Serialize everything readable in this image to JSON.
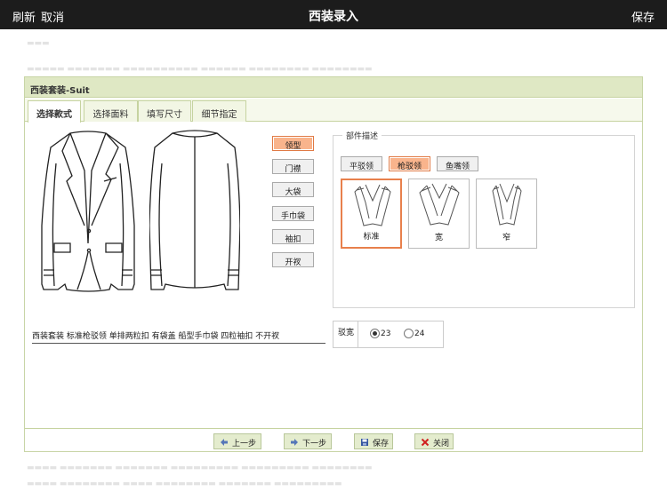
{
  "topbar": {
    "refresh": "刷新",
    "cancel": "取消",
    "title": "西装录入",
    "save": "保存"
  },
  "dialog": {
    "title": "西装套装-Suit",
    "tabs": [
      {
        "label": "选择款式",
        "active": true
      },
      {
        "label": "选择面料",
        "active": false
      },
      {
        "label": "填写尺寸",
        "active": false
      },
      {
        "label": "细节指定",
        "active": false
      }
    ],
    "parts": [
      {
        "label": "领型",
        "selected": true
      },
      {
        "label": "门襟",
        "selected": false
      },
      {
        "label": "大袋",
        "selected": false
      },
      {
        "label": "手巾袋",
        "selected": false
      },
      {
        "label": "袖扣",
        "selected": false
      },
      {
        "label": "开衩",
        "selected": false
      }
    ],
    "fieldset_legend": "部件描述",
    "lapel_types": [
      {
        "label": "平驳领",
        "selected": false
      },
      {
        "label": "枪驳领",
        "selected": true
      },
      {
        "label": "鱼嘴领",
        "selected": false
      }
    ],
    "widths": [
      {
        "label": "标准",
        "selected": true
      },
      {
        "label": "宽",
        "selected": false
      },
      {
        "label": "窄",
        "selected": false
      }
    ],
    "description": "西装套装 标准枪驳领 单排两粒扣 有袋盖 船型手巾袋 四粒袖扣 不开衩",
    "lapel_width": {
      "label": "驳宽",
      "options": [
        {
          "label": "23",
          "selected": true
        },
        {
          "label": "24",
          "selected": false
        }
      ]
    },
    "footer": {
      "prev": "上一步",
      "next": "下一步",
      "save": "保存",
      "close": "关闭"
    }
  },
  "colors": {
    "topbar_bg": "#1c1c1c",
    "header_bg": "#dfe8c4",
    "selected_fill": "#f9b48c",
    "selected_border": "#e07a45",
    "footer_btn_bg": "#e4ecce"
  }
}
